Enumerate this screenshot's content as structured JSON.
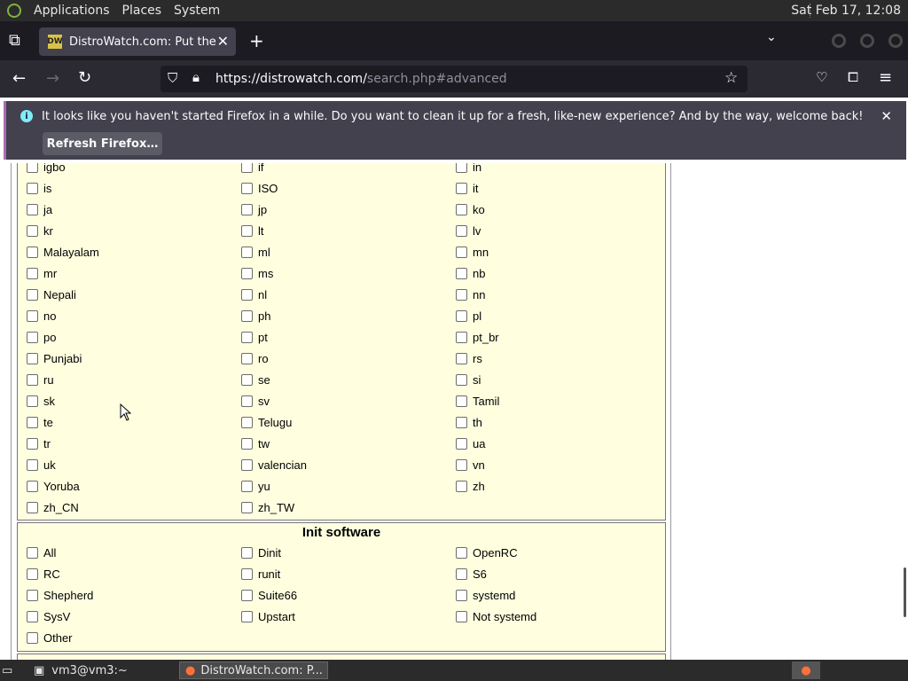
{
  "top_panel": {
    "menu": [
      "Applications",
      "Places",
      "System"
    ],
    "clock": "Sat Feb 17, 12:08"
  },
  "browser": {
    "tab_title": "DistroWatch.com: Put the fun back into computing",
    "favicon_text": "DW",
    "url_host": "https://distrowatch.com/",
    "url_path": "search.php#advanced"
  },
  "notification": {
    "message": "It looks like you haven't started Firefox in a while. Do you want to clean it up for a fresh, like-new experience? And by the way, welcome back!",
    "button": "Refresh Firefox…"
  },
  "languages": {
    "rows": [
      [
        "igbo",
        "if",
        "in"
      ],
      [
        "is",
        "ISO",
        "it"
      ],
      [
        "ja",
        "jp",
        "ko"
      ],
      [
        "kr",
        "lt",
        "lv"
      ],
      [
        "Malayalam",
        "ml",
        "mn"
      ],
      [
        "mr",
        "ms",
        "nb"
      ],
      [
        "Nepali",
        "nl",
        "nn"
      ],
      [
        "no",
        "ph",
        "pl"
      ],
      [
        "po",
        "pt",
        "pt_br"
      ],
      [
        "Punjabi",
        "ro",
        "rs"
      ],
      [
        "ru",
        "se",
        "si"
      ],
      [
        "sk",
        "sv",
        "Tamil"
      ],
      [
        "te",
        "Telugu",
        "th"
      ],
      [
        "tr",
        "tw",
        "ua"
      ],
      [
        "uk",
        "valencian",
        "vn"
      ],
      [
        "Yoruba",
        "yu",
        "zh"
      ],
      [
        "zh_CN",
        "zh_TW",
        ""
      ]
    ]
  },
  "init_software": {
    "title": "Init software",
    "rows": [
      [
        "All",
        "Dinit",
        "OpenRC"
      ],
      [
        "RC",
        "runit",
        "S6"
      ],
      [
        "Shepherd",
        "Suite66",
        "systemd"
      ],
      [
        "SysV",
        "Upstart",
        "Not systemd"
      ],
      [
        "Other",
        "",
        ""
      ]
    ]
  },
  "taskbar": {
    "items": [
      "vm3@vm3:~",
      "DistroWatch.com: P..."
    ]
  }
}
